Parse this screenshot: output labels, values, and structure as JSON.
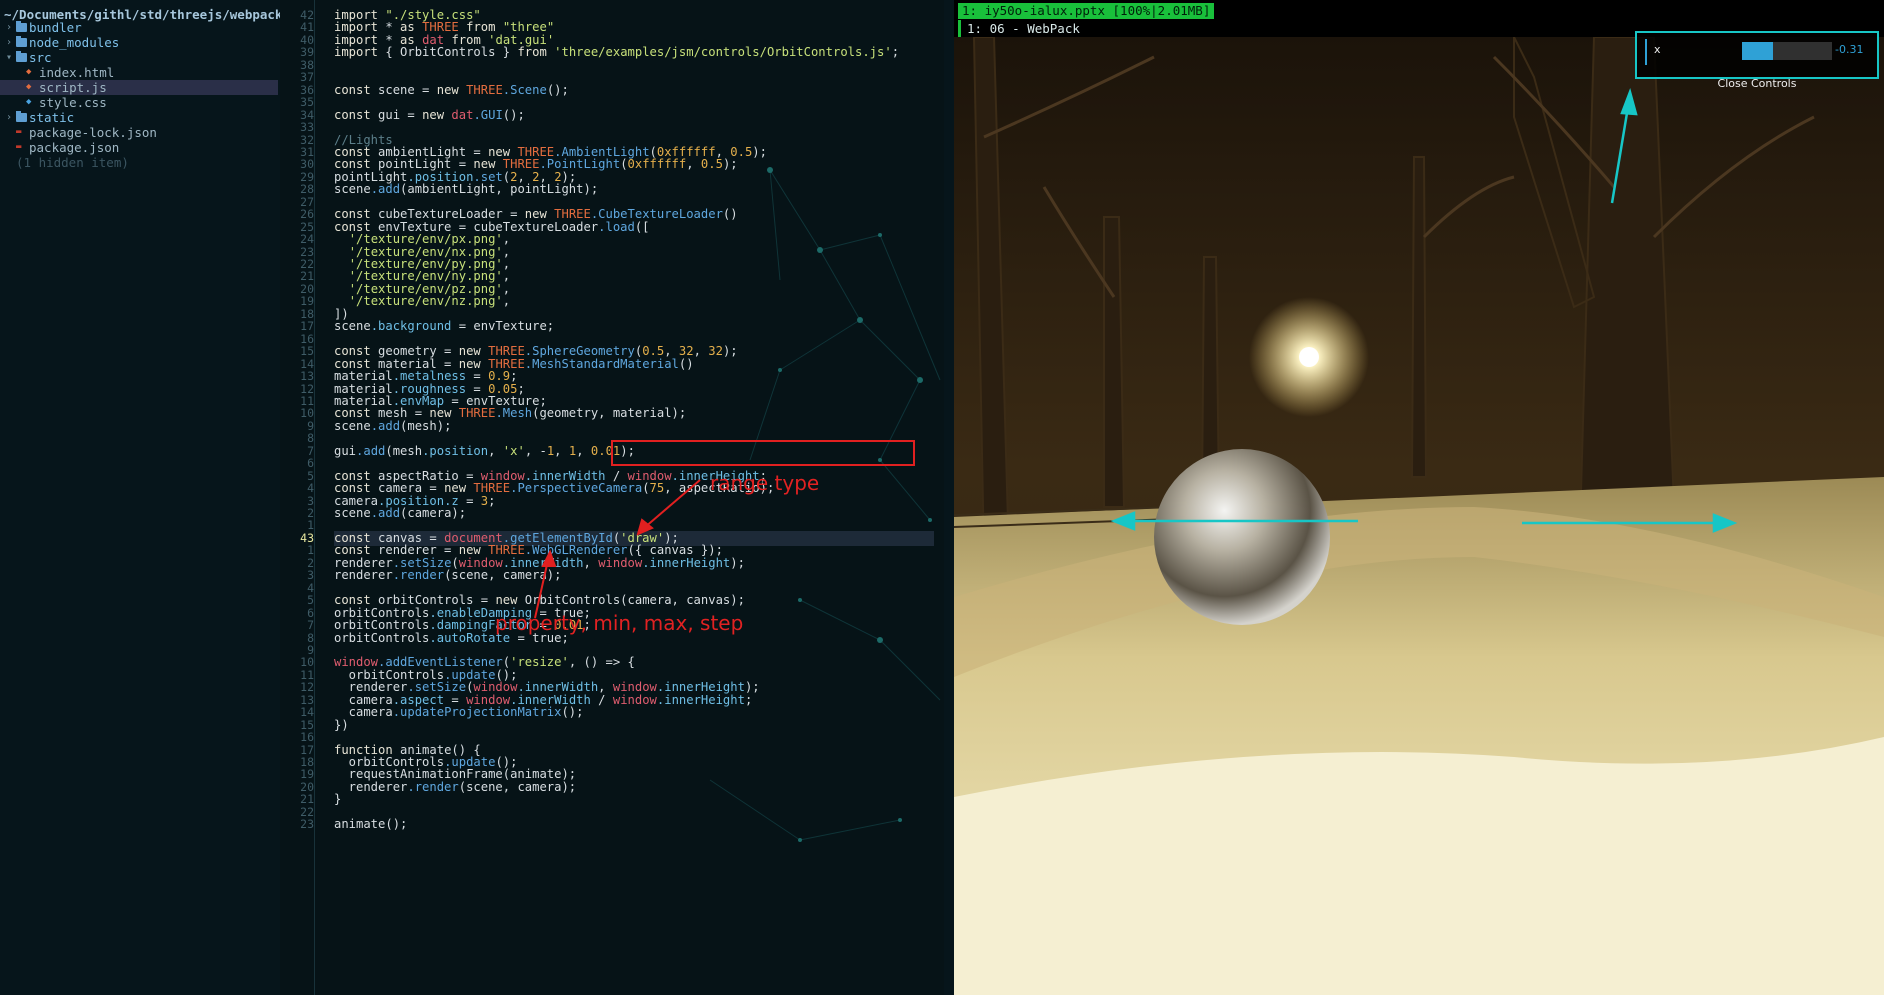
{
  "tree": {
    "path": "~/Documents/githl/std/threejs/webpack",
    "items": [
      {
        "label": "bundler",
        "type": "folder",
        "depth": 0
      },
      {
        "label": "node_modules",
        "type": "folder",
        "depth": 0
      },
      {
        "label": "src",
        "type": "folder-open",
        "depth": 0
      },
      {
        "label": "index.html",
        "type": "file",
        "depth": 1
      },
      {
        "label": "script.js",
        "type": "file",
        "depth": 1
      },
      {
        "label": "style.css",
        "type": "file",
        "depth": 1
      },
      {
        "label": "static",
        "type": "folder",
        "depth": 0
      },
      {
        "label": "package-lock.json",
        "type": "file",
        "depth": 0
      },
      {
        "label": "package.json",
        "type": "file",
        "depth": 0
      },
      {
        "label": "(1 hidden item)",
        "type": "hint",
        "depth": 0
      }
    ]
  },
  "editor": {
    "current_line": 43,
    "lines": [
      {
        "n": "42",
        "t": "import \"./style.css\""
      },
      {
        "n": "41",
        "t": "import * as THREE from \"three\""
      },
      {
        "n": "40",
        "t": "import * as dat from 'dat.gui'"
      },
      {
        "n": "39",
        "t": "import { OrbitControls } from 'three/examples/jsm/controls/OrbitControls.js';"
      },
      {
        "n": "38",
        "t": ""
      },
      {
        "n": "37",
        "t": ""
      },
      {
        "n": "36",
        "t": "const scene = new THREE.Scene();"
      },
      {
        "n": "35",
        "t": ""
      },
      {
        "n": "34",
        "t": "const gui = new dat.GUI();"
      },
      {
        "n": "33",
        "t": ""
      },
      {
        "n": "32",
        "t": "//Lights"
      },
      {
        "n": "31",
        "t": "const ambientLight = new THREE.AmbientLight(0xffffff, 0.5);"
      },
      {
        "n": "30",
        "t": "const pointLight = new THREE.PointLight(0xffffff, 0.5);"
      },
      {
        "n": "29",
        "t": "pointLight.position.set(2, 2, 2);"
      },
      {
        "n": "28",
        "t": "scene.add(ambientLight, pointLight);"
      },
      {
        "n": "27",
        "t": ""
      },
      {
        "n": "26",
        "t": "const cubeTextureLoader = new THREE.CubeTextureLoader()"
      },
      {
        "n": "25",
        "t": "const envTexture = cubeTextureLoader.load(["
      },
      {
        "n": "24",
        "t": "  '/texture/env/px.png',"
      },
      {
        "n": "23",
        "t": "  '/texture/env/nx.png',"
      },
      {
        "n": "22",
        "t": "  '/texture/env/py.png',"
      },
      {
        "n": "21",
        "t": "  '/texture/env/ny.png',"
      },
      {
        "n": "20",
        "t": "  '/texture/env/pz.png',"
      },
      {
        "n": "19",
        "t": "  '/texture/env/nz.png',"
      },
      {
        "n": "18",
        "t": "])"
      },
      {
        "n": "17",
        "t": "scene.background = envTexture;"
      },
      {
        "n": "16",
        "t": ""
      },
      {
        "n": "15",
        "t": "const geometry = new THREE.SphereGeometry(0.5, 32, 32);"
      },
      {
        "n": "14",
        "t": "const material = new THREE.MeshStandardMaterial()"
      },
      {
        "n": "13",
        "t": "material.metalness = 0.9;"
      },
      {
        "n": "12",
        "t": "material.roughness = 0.05;"
      },
      {
        "n": "11",
        "t": "material.envMap = envTexture;"
      },
      {
        "n": "10",
        "t": "const mesh = new THREE.Mesh(geometry, material);"
      },
      {
        "n": "9",
        "t": "scene.add(mesh);"
      },
      {
        "n": "8",
        "t": ""
      },
      {
        "n": "7",
        "t": "gui.add(mesh.position, 'x', -1, 1, 0.01);"
      },
      {
        "n": "6",
        "t": ""
      },
      {
        "n": "5",
        "t": "const aspectRatio = window.innerWidth / window.innerHeight;"
      },
      {
        "n": "4",
        "t": "const camera = new THREE.PerspectiveCamera(75, aspectRatio);"
      },
      {
        "n": "3",
        "t": "camera.position.z = 3;"
      },
      {
        "n": "2",
        "t": "scene.add(camera);"
      },
      {
        "n": "1",
        "t": ""
      },
      {
        "n": "43",
        "t": "const canvas = document.getElementById('draw');"
      },
      {
        "n": "1",
        "t": "const renderer = new THREE.WebGLRenderer({ canvas });"
      },
      {
        "n": "2",
        "t": "renderer.setSize(window.innerWidth, window.innerHeight);"
      },
      {
        "n": "3",
        "t": "renderer.render(scene, camera);"
      },
      {
        "n": "4",
        "t": ""
      },
      {
        "n": "5",
        "t": "const orbitControls = new OrbitControls(camera, canvas);"
      },
      {
        "n": "6",
        "t": "orbitControls.enableDamping = true;"
      },
      {
        "n": "7",
        "t": "orbitControls.dampingFactor = 0.01;"
      },
      {
        "n": "8",
        "t": "orbitControls.autoRotate = true;"
      },
      {
        "n": "9",
        "t": ""
      },
      {
        "n": "10",
        "t": "window.addEventListener('resize', () => {"
      },
      {
        "n": "11",
        "t": "  orbitControls.update();"
      },
      {
        "n": "12",
        "t": "  renderer.setSize(window.innerWidth, window.innerHeight);"
      },
      {
        "n": "13",
        "t": "  camera.aspect = window.innerWidth / window.innerHeight;"
      },
      {
        "n": "14",
        "t": "  camera.updateProjectionMatrix();"
      },
      {
        "n": "15",
        "t": "})"
      },
      {
        "n": "16",
        "t": ""
      },
      {
        "n": "17",
        "t": "function animate() {"
      },
      {
        "n": "18",
        "t": "  orbitControls.update();"
      },
      {
        "n": "19",
        "t": "  requestAnimationFrame(animate);"
      },
      {
        "n": "20",
        "t": "  renderer.render(scene, camera);"
      },
      {
        "n": "21",
        "t": "}"
      },
      {
        "n": "22",
        "t": ""
      },
      {
        "n": "23",
        "t": "animate();"
      }
    ],
    "annotations": {
      "range_type": "range type",
      "params": "property, min, max, step"
    }
  },
  "viewer": {
    "title": "1: iy50o-ialux.pptx [100%|2.01MB]",
    "subtitle": "1: 06 - WebPack"
  },
  "gui": {
    "property": "x",
    "value": "-0.31",
    "slider_fraction": 0.345,
    "close_label": "Close Controls"
  },
  "colors": {
    "accent": "#17c6c6",
    "annotation": "#e12020",
    "gui_blue": "#2fa1d6",
    "title_green": "#19c03b"
  }
}
